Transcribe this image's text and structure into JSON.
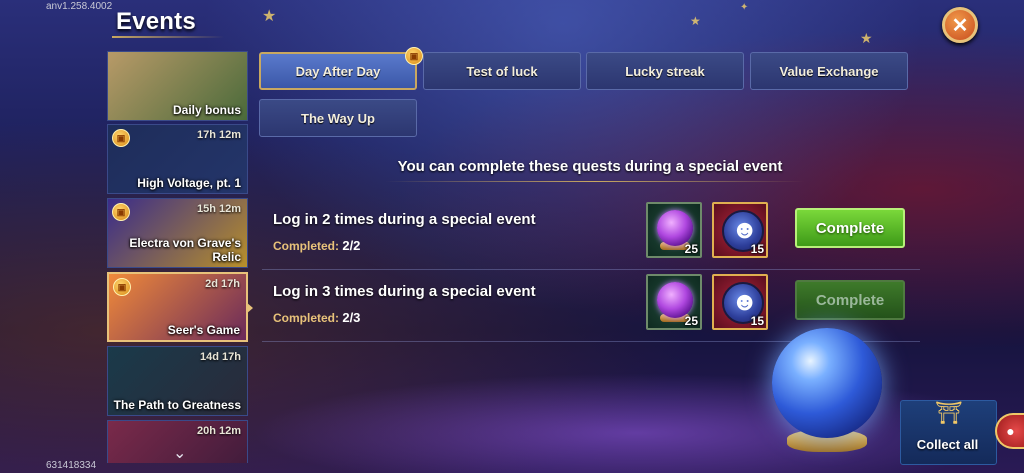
{
  "app": {
    "version": "anv1.258.4002",
    "user_id": "631418334",
    "title": "Events"
  },
  "sidebar": {
    "items": [
      {
        "name": "Daily bonus",
        "time": "",
        "gift": false,
        "active": false,
        "color_a": "#b89a68",
        "color_b": "#4a6a3a"
      },
      {
        "name": "High Voltage, pt. 1",
        "time": "17h 12m",
        "gift": true,
        "active": false,
        "color_a": "#1e2d5a",
        "color_b": "#24356a"
      },
      {
        "name": "Electra von Grave's Relic",
        "time": "15h 12m",
        "gift": true,
        "active": false,
        "color_a": "#3a2c8a",
        "color_b": "#b8902a"
      },
      {
        "name": "Seer's Game",
        "time": "2d 17h",
        "gift": true,
        "active": true,
        "color_a": "#f08a3a",
        "color_b": "#6a2a5a"
      },
      {
        "name": "The Path to Greatness",
        "time": "14d 17h",
        "gift": false,
        "active": false,
        "color_a": "#1a3a4a",
        "color_b": "#2a2a3a"
      },
      {
        "name": "",
        "time": "20h 12m",
        "gift": false,
        "active": false,
        "color_a": "#7a2a4a",
        "color_b": "#3a1a3a"
      }
    ]
  },
  "tabs": [
    {
      "label": "Day After Day",
      "active": true
    },
    {
      "label": "Test of luck",
      "active": false
    },
    {
      "label": "Lucky streak",
      "active": false
    },
    {
      "label": "Value Exchange",
      "active": false
    },
    {
      "label": "The Way Up",
      "active": false
    }
  ],
  "subtitle": "You can complete these quests during a special event",
  "quests": [
    {
      "title": "Log in 2 times during a special event",
      "progress_label": "Completed:",
      "progress_value": "2/2",
      "rewards": [
        {
          "icon": "purple-orb-icon",
          "qty": "25"
        },
        {
          "icon": "hero-token-icon",
          "qty": "15"
        }
      ],
      "button": "Complete",
      "enabled": true
    },
    {
      "title": "Log in 3 times during a special event",
      "progress_label": "Completed:",
      "progress_value": "2/3",
      "rewards": [
        {
          "icon": "purple-orb-icon",
          "qty": "25"
        },
        {
          "icon": "hero-token-icon",
          "qty": "15"
        }
      ],
      "button": "Complete",
      "enabled": false
    }
  ],
  "collect_all": "Collect all"
}
